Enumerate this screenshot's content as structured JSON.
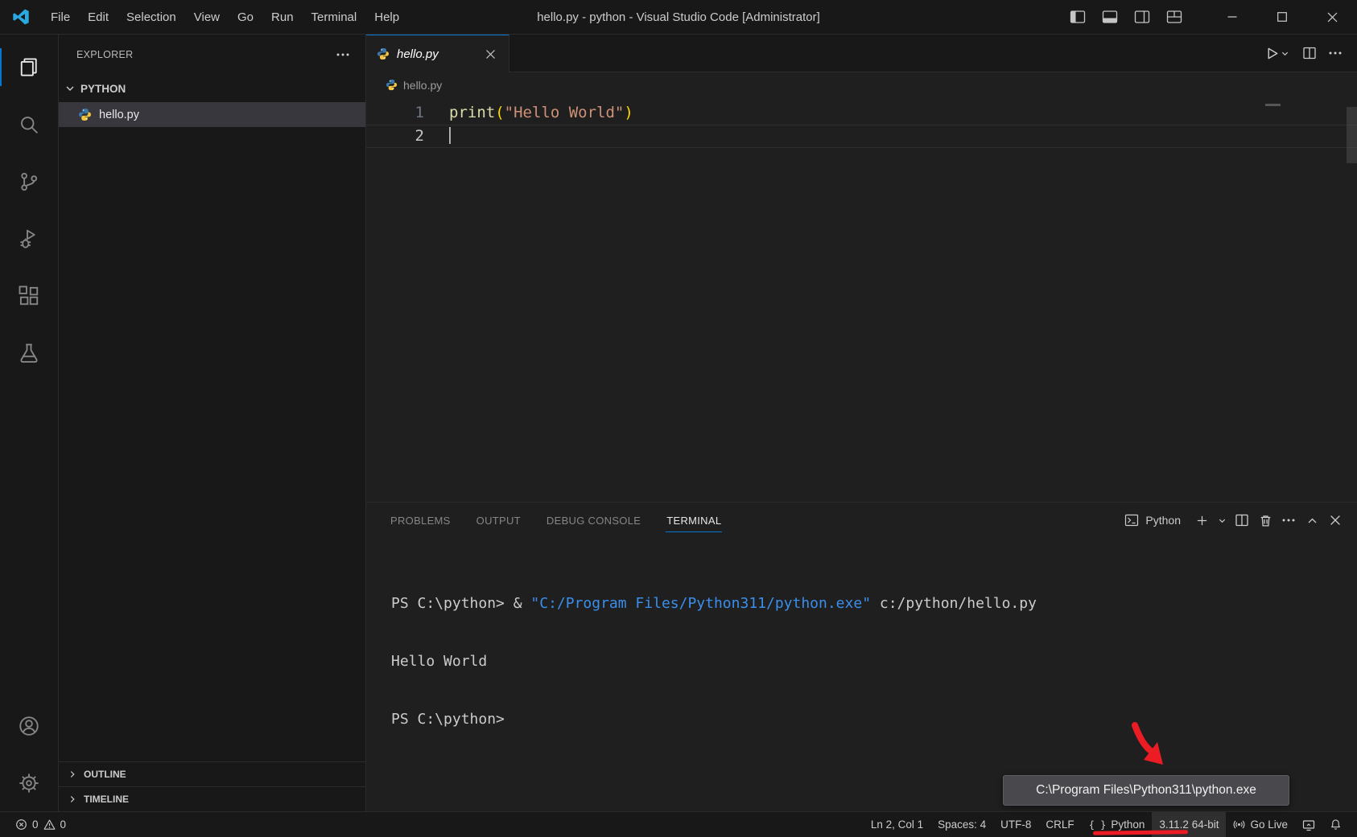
{
  "titlebar": {
    "menus": [
      "File",
      "Edit",
      "Selection",
      "View",
      "Go",
      "Run",
      "Terminal",
      "Help"
    ],
    "title": "hello.py - python - Visual Studio Code [Administrator]"
  },
  "sidebar": {
    "title": "EXPLORER",
    "section": "PYTHON",
    "file": "hello.py",
    "outline": "OUTLINE",
    "timeline": "TIMELINE"
  },
  "editor": {
    "tab": "hello.py",
    "breadcrumb": "hello.py",
    "lines": {
      "n1": "1",
      "n2": "2"
    },
    "code": {
      "fn": "print",
      "open": "(",
      "str": "\"Hello World\"",
      "close": ")"
    }
  },
  "panel": {
    "tabs": [
      "PROBLEMS",
      "OUTPUT",
      "DEBUG CONSOLE",
      "TERMINAL"
    ],
    "shell": "Python",
    "terminal": {
      "l1a": "PS C:\\python> & ",
      "l1b": "\"C:/Program Files/Python311/python.exe\"",
      "l1c": " c:/python/hello.py",
      "l2": "Hello World",
      "l3": "PS C:\\python>"
    }
  },
  "status": {
    "errors": "0",
    "warnings": "0",
    "ln_col": "Ln 2, Col 1",
    "spaces": "Spaces: 4",
    "encoding": "UTF-8",
    "eol": "CRLF",
    "lang": "Python",
    "version": "3.11.2 64-bit",
    "golive": "Go Live"
  },
  "icons": {
    "braces": "{ }"
  },
  "tooltip": "C:\\Program Files\\Python311\\python.exe",
  "colors": {
    "accent": "#0078d4",
    "annotation": "#ec1c24"
  }
}
